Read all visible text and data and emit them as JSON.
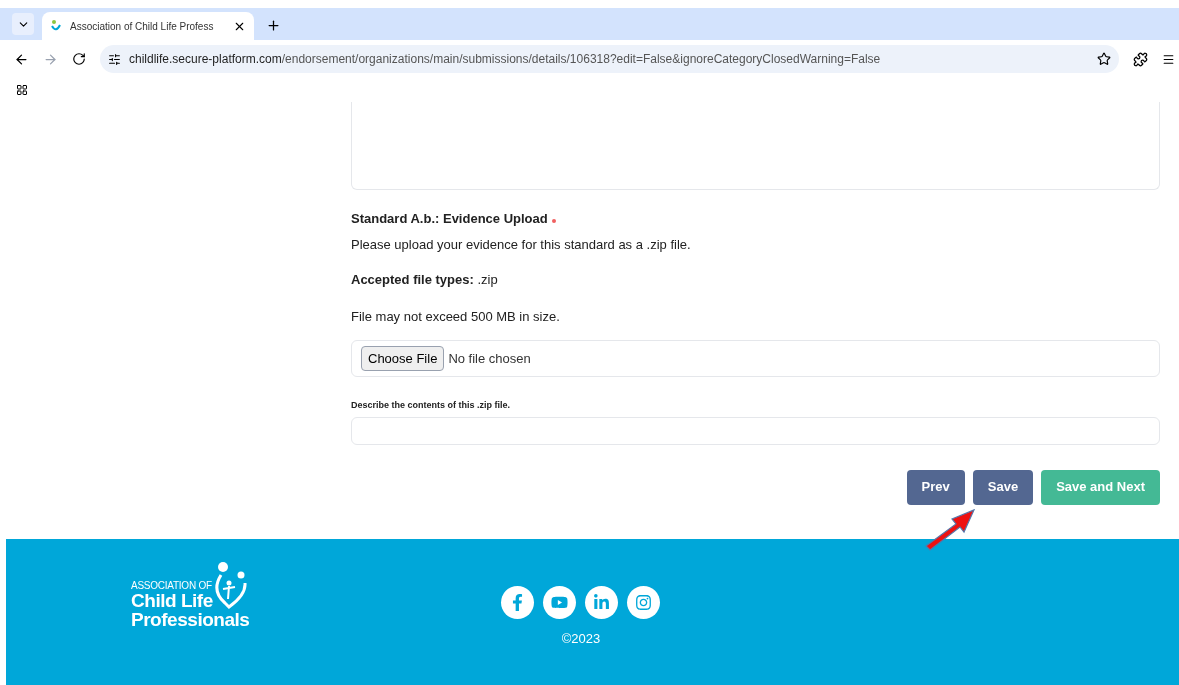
{
  "browser": {
    "tab": {
      "title": "Association of Child Life Profess",
      "selected": true
    },
    "url": {
      "host": "childlife.secure-platform.com",
      "path": "/endorsement/organizations/main/submissions/details/106318?edit=False&ignoreCategoryClosedWarning=False"
    }
  },
  "form": {
    "heading": "Standard A.b.: Evidence Upload",
    "required": true,
    "instructions": "Please upload your evidence for this standard as a .zip file.",
    "accepted_label": "Accepted file types:",
    "accepted_value": ".zip",
    "size_note": "File may not exceed 500 MB in size.",
    "file_button": "Choose File",
    "file_status": "No file chosen",
    "describe_label": "Describe the contents of this .zip file."
  },
  "buttons": [
    {
      "label": "Prev",
      "kind": "secondary"
    },
    {
      "label": "Save",
      "kind": "secondary"
    },
    {
      "label": "Save and Next",
      "kind": "primary"
    }
  ],
  "footer": {
    "logo": {
      "line_1": "ASSOCIATION OF",
      "line_2": "Child Life",
      "line_3": "Professionals"
    },
    "socials": [
      {
        "kind": "facebook"
      },
      {
        "kind": "youtube"
      },
      {
        "kind": "linkedin"
      },
      {
        "kind": "instagram"
      }
    ],
    "copyright": "©2023"
  }
}
